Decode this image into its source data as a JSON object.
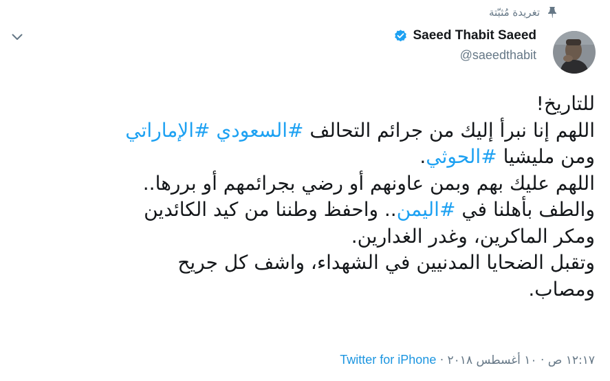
{
  "header": {
    "pinned_label": "تغريدة مُثبّتة",
    "icon": "pin-icon"
  },
  "menu": {
    "icon": "chevron-down-icon"
  },
  "author": {
    "display_name": "Saeed Thabit Saeed",
    "handle": "@saeedthabit",
    "verified_icon": "verified-badge-icon",
    "avatar": "avatar"
  },
  "tweet": {
    "lines": [
      [
        {
          "text": "للتاريخ!",
          "tag": false
        }
      ],
      [
        {
          "text": "اللهم إنا نبرأ إليك من جرائم التحالف ",
          "tag": false
        },
        {
          "text": "#السعودي",
          "tag": true
        },
        {
          "text": " ",
          "tag": false
        },
        {
          "text": "#الإماراتي",
          "tag": true
        }
      ],
      [
        {
          "text": "ومن مليشيا ",
          "tag": false
        },
        {
          "text": "#الحوثي",
          "tag": true
        },
        {
          "text": ".",
          "tag": false
        }
      ],
      [
        {
          "text": "اللهم عليك بهم وبمن عاونهم أو رضي بجرائمهم أو بررها..",
          "tag": false
        }
      ],
      [
        {
          "text": "والطف بأهلنا في ",
          "tag": false
        },
        {
          "text": "#اليمن",
          "tag": true
        },
        {
          "text": ".. واحفظ وطننا من كيد الكائدين",
          "tag": false
        }
      ],
      [
        {
          "text": "ومكر الماكرين، وغدر الغدارين.",
          "tag": false
        }
      ],
      [
        {
          "text": "وتقبل الضحايا المدنيين في الشهداء، واشف كل جريح",
          "tag": false
        }
      ],
      [
        {
          "text": "ومصاب.",
          "tag": false
        }
      ]
    ]
  },
  "meta": {
    "timestamp": "١٢:١٧ ص · ١٠ أغسطس ٢٠١٨",
    "separator": " · ",
    "source": "Twitter for iPhone"
  },
  "colors": {
    "text": "#14171a",
    "secondary": "#657786",
    "link": "#1da1f2",
    "verified": "#1da1f2"
  }
}
